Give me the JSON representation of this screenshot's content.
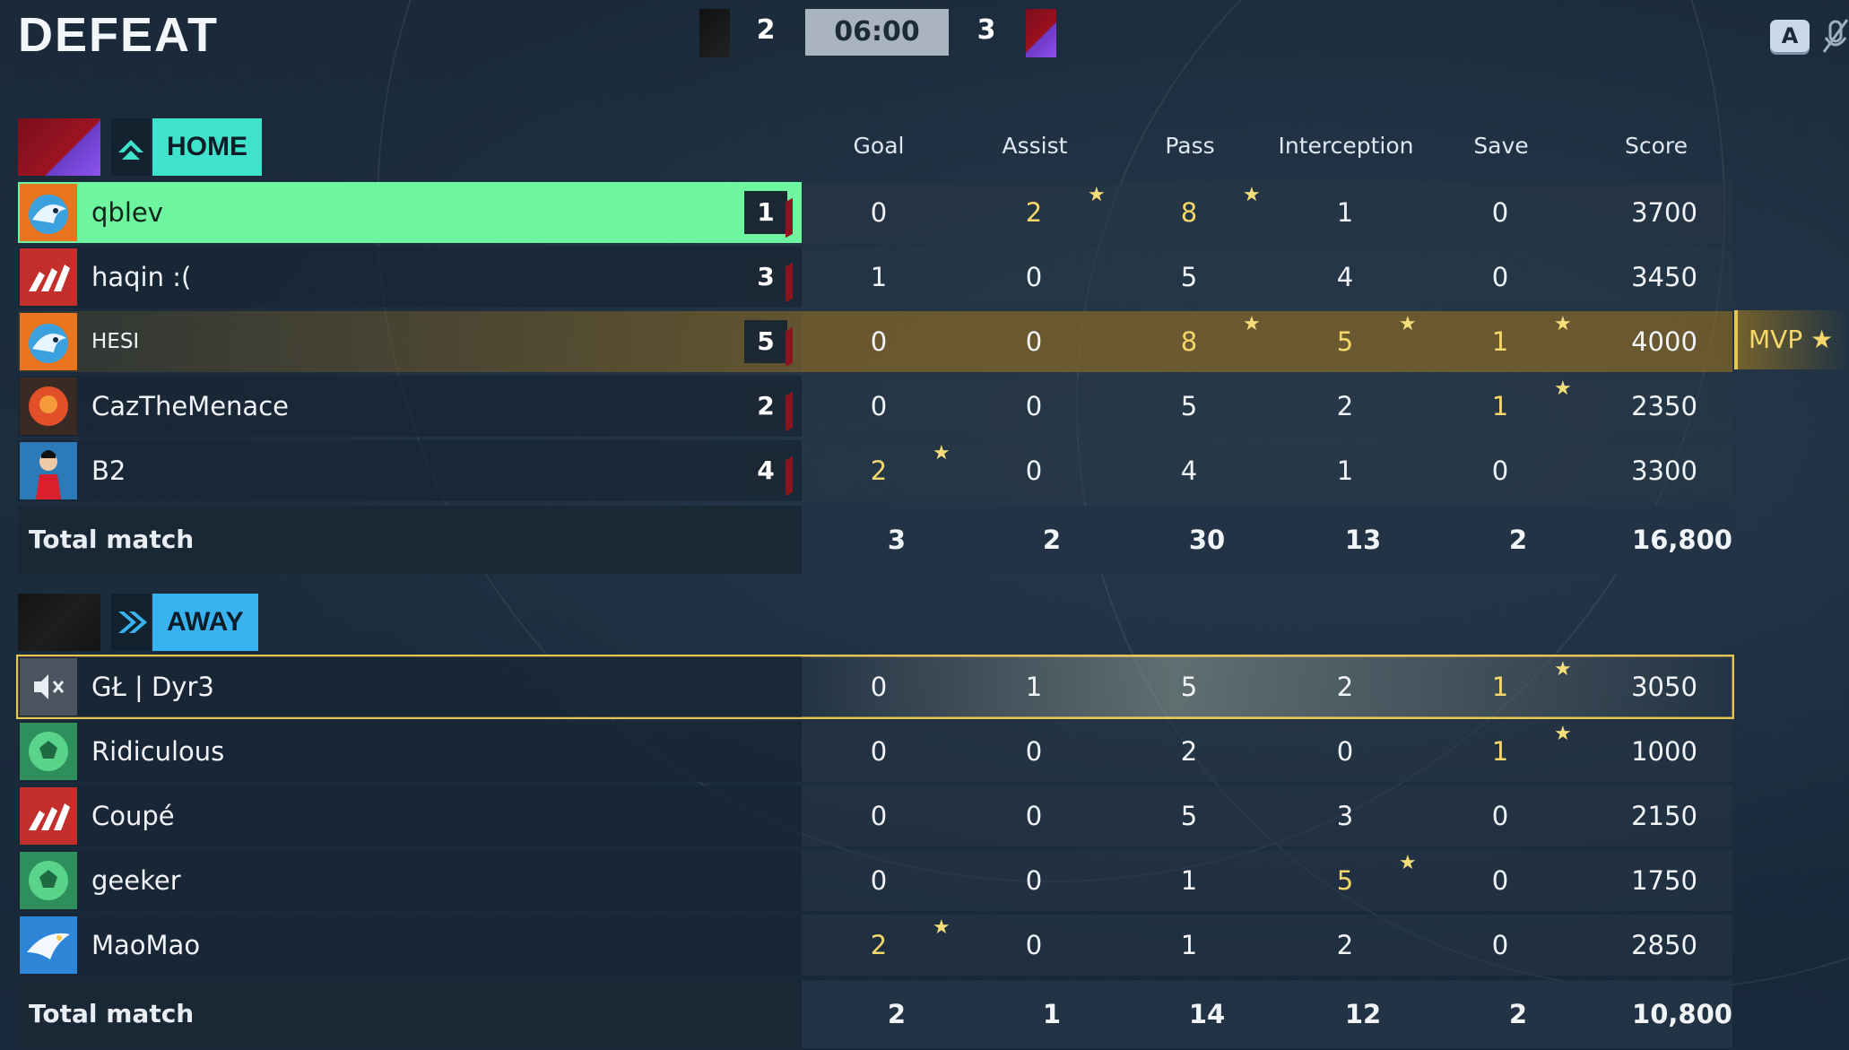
{
  "header": {
    "result": "DEFEAT",
    "home_score": "2",
    "away_score": "3",
    "timer": "06:00",
    "key_hint": "A"
  },
  "columns": [
    "Goal",
    "Assist",
    "Pass",
    "Interception",
    "Save",
    "Score"
  ],
  "home": {
    "label": "HOME",
    "players": [
      {
        "name": "qblev",
        "rank": "1",
        "stats": [
          "0",
          "2",
          "8",
          "1",
          "0",
          "3700"
        ],
        "highlight": [
          false,
          true,
          true,
          false,
          false,
          false
        ],
        "stars": [
          false,
          true,
          true,
          false,
          false,
          false
        ],
        "avatar": "shark-avatar"
      },
      {
        "name": "haqin :(",
        "rank": "3",
        "stats": [
          "1",
          "0",
          "5",
          "4",
          "0",
          "3450"
        ],
        "highlight": [
          false,
          false,
          false,
          false,
          false,
          false
        ],
        "stars": [
          false,
          false,
          false,
          false,
          false,
          false
        ],
        "avatar": "stripes-avatar"
      },
      {
        "name": "HESI",
        "rank": "5",
        "stats": [
          "0",
          "0",
          "8",
          "5",
          "1",
          "4000"
        ],
        "highlight": [
          false,
          false,
          true,
          true,
          true,
          false
        ],
        "stars": [
          false,
          false,
          true,
          true,
          true,
          false
        ],
        "avatar": "shark-avatar"
      },
      {
        "name": "CazTheMenace",
        "rank": "2",
        "stats": [
          "0",
          "0",
          "5",
          "2",
          "1",
          "2350"
        ],
        "highlight": [
          false,
          false,
          false,
          false,
          true,
          false
        ],
        "stars": [
          false,
          false,
          false,
          false,
          true,
          false
        ],
        "avatar": "orb-avatar"
      },
      {
        "name": "B2",
        "rank": "4",
        "stats": [
          "2",
          "0",
          "4",
          "1",
          "0",
          "3300"
        ],
        "highlight": [
          true,
          false,
          false,
          false,
          false,
          false
        ],
        "stars": [
          true,
          false,
          false,
          false,
          false,
          false
        ],
        "avatar": "player-avatar"
      }
    ],
    "total": {
      "label": "Total match",
      "values": [
        "3",
        "2",
        "30",
        "13",
        "2",
        "16,800"
      ]
    }
  },
  "away": {
    "label": "AWAY",
    "players": [
      {
        "name": "GŁ | Dyr3",
        "stats": [
          "0",
          "1",
          "5",
          "2",
          "1",
          "3050"
        ],
        "highlight": [
          false,
          false,
          false,
          false,
          true,
          false
        ],
        "stars": [
          false,
          false,
          false,
          false,
          true,
          false
        ],
        "avatar": "muted-avatar"
      },
      {
        "name": "Ridiculous",
        "stats": [
          "0",
          "0",
          "2",
          "0",
          "1",
          "1000"
        ],
        "highlight": [
          false,
          false,
          false,
          false,
          true,
          false
        ],
        "stars": [
          false,
          false,
          false,
          false,
          true,
          false
        ],
        "avatar": "ball-avatar"
      },
      {
        "name": "Coupé",
        "stats": [
          "0",
          "0",
          "5",
          "3",
          "0",
          "2150"
        ],
        "highlight": [
          false,
          false,
          false,
          false,
          false,
          false
        ],
        "stars": [
          false,
          false,
          false,
          false,
          false,
          false
        ],
        "avatar": "stripes-avatar"
      },
      {
        "name": "geeker",
        "stats": [
          "0",
          "0",
          "1",
          "5",
          "0",
          "1750"
        ],
        "highlight": [
          false,
          false,
          false,
          true,
          false,
          false
        ],
        "stars": [
          false,
          false,
          false,
          true,
          false,
          false
        ],
        "avatar": "ball-avatar"
      },
      {
        "name": "MaoMao",
        "stats": [
          "2",
          "0",
          "1",
          "2",
          "0",
          "2850"
        ],
        "highlight": [
          true,
          false,
          false,
          false,
          false,
          false
        ],
        "stars": [
          true,
          false,
          false,
          false,
          false,
          false
        ],
        "avatar": "bird-avatar"
      }
    ],
    "total": {
      "label": "Total match",
      "values": [
        "2",
        "1",
        "14",
        "12",
        "2",
        "10,800"
      ]
    }
  },
  "mvp_label": "MVP ★",
  "colors": {
    "home_accent": "#3fe3cc",
    "away_accent": "#39b3f0",
    "self_row": "#6ef59f",
    "mvp_gold": "#f6d76a"
  }
}
